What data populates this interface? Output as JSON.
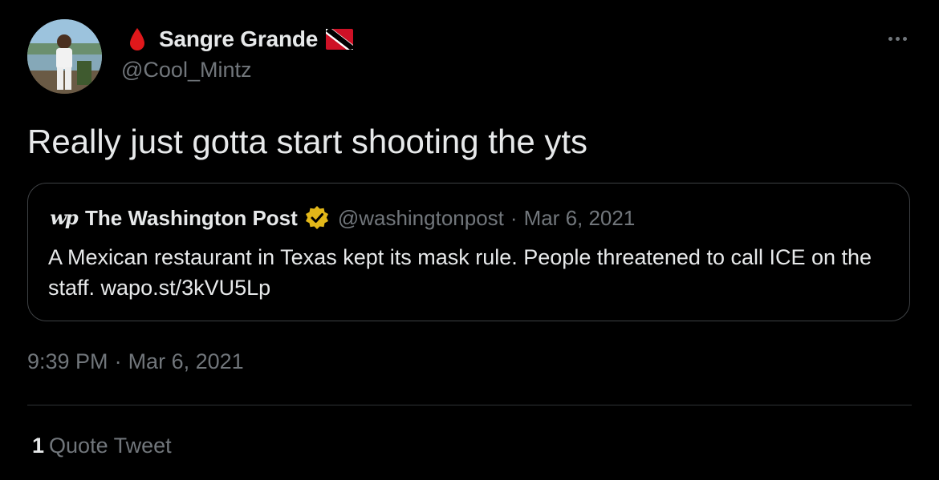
{
  "author": {
    "display_name": "Sangre Grande",
    "handle": "@Cool_Mintz",
    "avatar_icon": "avatar-photo",
    "name_prefix_icon": "blood-drop-icon",
    "name_suffix_icon": "trinidad-tobago-flag-icon"
  },
  "tweet": {
    "text": "Really just gotta start shooting the yts",
    "time": "9:39 PM",
    "separator": "·",
    "date": "Mar 6, 2021"
  },
  "quoted": {
    "logo_text": "wp",
    "name": "The Washington Post",
    "verified_icon": "verified-badge-icon",
    "handle": "@washingtonpost",
    "separator": "·",
    "date": "Mar 6, 2021",
    "text": "A Mexican restaurant in Texas kept its mask rule. People threatened to call ICE on the staff. wapo.st/3kVU5Lp"
  },
  "stats": {
    "quote_count": "1",
    "quote_label": "Quote Tweet"
  },
  "colors": {
    "background": "#000000",
    "primary_text": "#e7e9ea",
    "secondary_text": "#71767b",
    "border": "#3e4144",
    "verified_gold": "#e2b719",
    "drop_red": "#e0181b"
  }
}
